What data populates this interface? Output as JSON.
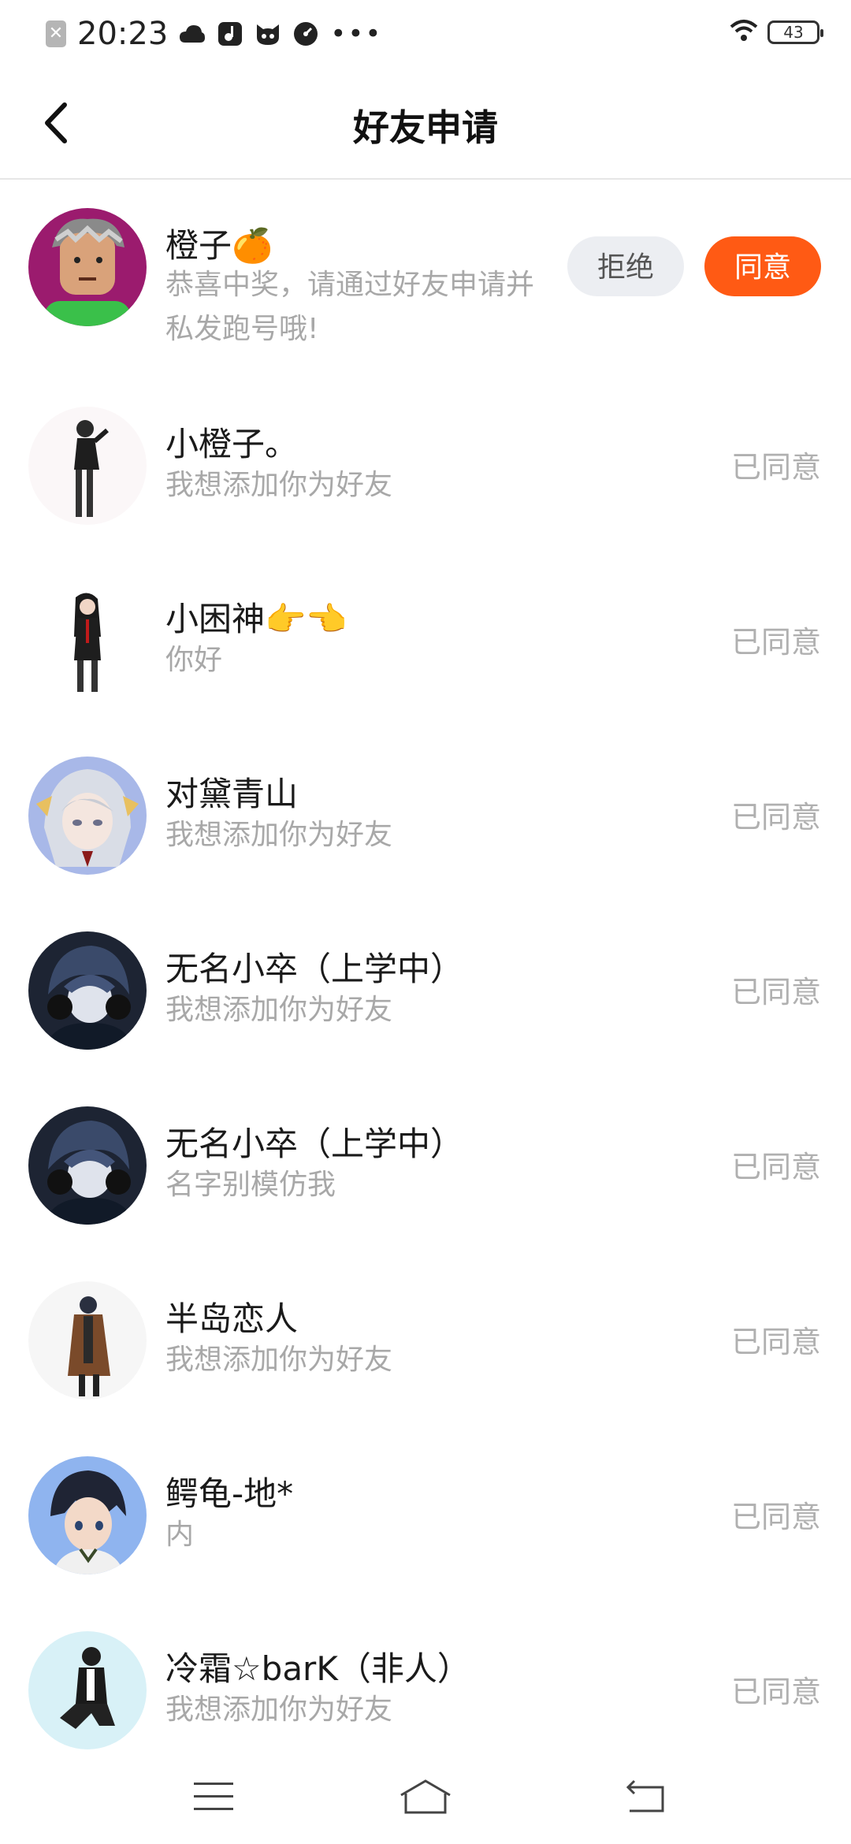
{
  "status": {
    "time": "20:23",
    "close_glyph": "✕",
    "more": "•••",
    "battery": "43",
    "icons": [
      "cloud-icon",
      "music-icon",
      "cat-icon",
      "speed-icon",
      "wifi-icon",
      "battery-icon"
    ]
  },
  "header": {
    "title": "好友申请",
    "back_icon": "back-arrow-icon"
  },
  "requests": [
    {
      "name": "橙子🍊",
      "message": "恭喜中奖，请通过好友申请并私发跑号哦!",
      "reject_label": "拒绝",
      "agree_label": "同意",
      "avatar": "gray-haired-cartoon-avatar"
    },
    {
      "name": "小橙子。",
      "message": "我想添加你为好友",
      "state": "已同意",
      "avatar": "anime-girl-black-outfit"
    },
    {
      "name": "小困神👉👈",
      "message": "你好",
      "state": "已同意",
      "avatar": "anime-girl-red-tie"
    },
    {
      "name": "对黛青山",
      "message": "我想添加你为好友",
      "state": "已同意",
      "avatar": "anime-silver-hair"
    },
    {
      "name": "无名小卒（上学中）",
      "message": "我想添加你为好友",
      "state": "已同意",
      "avatar": "anime-boy-headphones"
    },
    {
      "name": "无名小卒（上学中）",
      "message": "名字别模仿我",
      "state": "已同意",
      "avatar": "anime-boy-headphones"
    },
    {
      "name": "半岛恋人",
      "message": "我想添加你为好友",
      "state": "已同意",
      "avatar": "anime-brown-coat"
    },
    {
      "name": "鳄龟-地*",
      "message": "内",
      "state": "已同意",
      "avatar": "anime-boy-dark-hair"
    },
    {
      "name": "冷霜☆barK（非人）",
      "message": "我想添加你为好友",
      "state": "已同意",
      "avatar": "anime-boy-sitting"
    }
  ],
  "navbar": {
    "icons": [
      "menu-icon",
      "home-icon",
      "back-icon"
    ]
  },
  "colors": {
    "accent": "#ff5a14",
    "muted_text": "#a8a8a8",
    "reject_bg": "#eceef2"
  }
}
